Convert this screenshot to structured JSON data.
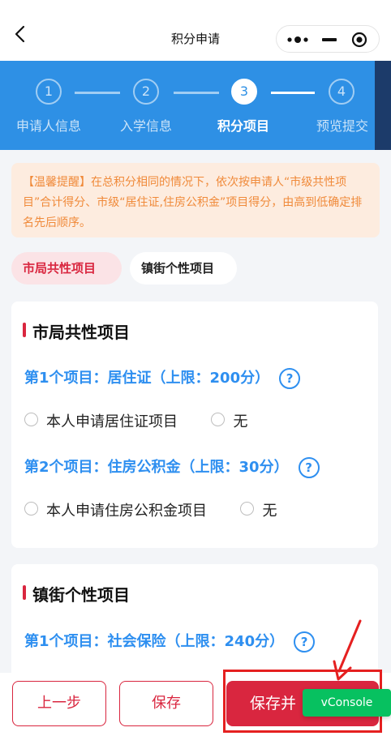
{
  "nav": {
    "title": "积分申请"
  },
  "steps": [
    {
      "num": "1",
      "label": "申请人信息",
      "active": false
    },
    {
      "num": "2",
      "label": "入学信息",
      "active": false
    },
    {
      "num": "3",
      "label": "积分项目",
      "active": true
    },
    {
      "num": "4",
      "label": "预览提交",
      "active": false
    }
  ],
  "tips": {
    "text": "【温馨提醒】在总积分相同的情况下，依次按申请人“市级共性项目”合计得分、市级“居住证,住房公积金”项目得分，由高到低确定排名先后顺序。"
  },
  "tabs": [
    {
      "label": "市局共性项目",
      "active": true
    },
    {
      "label": "镇街个性项目",
      "active": false
    }
  ],
  "section1": {
    "title": "市局共性项目",
    "items": [
      {
        "title": "第1个项目：居住证（上限：200分）",
        "help": "?",
        "options": [
          "本人申请居住证项目",
          "无"
        ]
      },
      {
        "title": "第2个项目：住房公积金（上限：30分）",
        "help": "?",
        "options": [
          "本人申请住房公积金项目",
          "无"
        ]
      }
    ]
  },
  "section2": {
    "title": "镇街个性项目",
    "items": [
      {
        "title": "第1个项目：社会保险（上限：240分）",
        "help": "?"
      }
    ]
  },
  "footer": {
    "prev_label": "上一步",
    "save_label": "保存",
    "next_label": "保存并"
  },
  "vconsole": {
    "label": "vConsole"
  },
  "colors": {
    "primary_blue": "#2e90e5",
    "accent_red": "#d9263f",
    "tip_orange": "#f08a3a",
    "vconsole_green": "#07c160"
  }
}
